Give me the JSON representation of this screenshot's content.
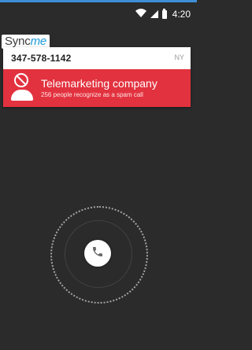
{
  "status_bar": {
    "time": "4:20"
  },
  "brand": {
    "name_part1": "Sync",
    "name_part2": "me"
  },
  "caller": {
    "number": "347-578-1142",
    "region": "NY"
  },
  "spam": {
    "title": "Telemarketing company",
    "subtitle": "256 people recognize as a spam call"
  },
  "icons": {
    "wifi": "wifi-icon",
    "signal": "signal-icon",
    "battery": "battery-icon",
    "block": "block-icon",
    "person": "person-icon",
    "phone": "phone-icon"
  },
  "colors": {
    "accent_blue": "#1a9ad8",
    "spam_red": "#e2323f",
    "background": "#2b2b2b"
  }
}
